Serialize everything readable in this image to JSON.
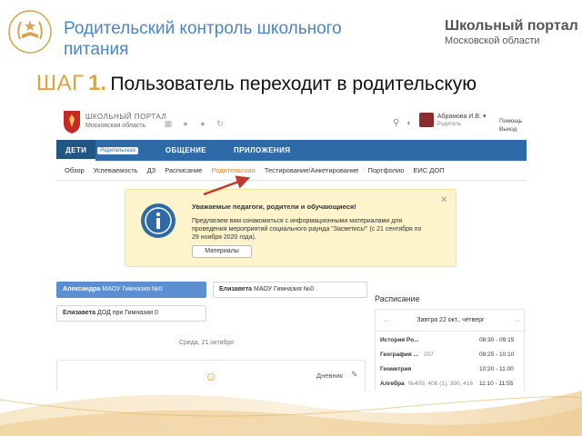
{
  "slide": {
    "title": "Родительский контроль школьного питания",
    "brand_line1": "Школьный портал",
    "brand_line2": "Московской области",
    "step_word": "ШАГ",
    "step_number": "1.",
    "step_text": "Пользователь переходит в родительскую"
  },
  "portal": {
    "logo_line1": "ШКОЛЬНЫЙ ПОРТАЛ",
    "logo_line2": "Московская область",
    "user_name": "Абрамова И.В. ▾",
    "user_role": "Родитель",
    "help_link": "Помощь",
    "logout_link": "Выход"
  },
  "nav": {
    "children": "ДЕТИ",
    "children_badge": "Родительская",
    "communication": "ОБЩЕНИЕ",
    "apps": "ПРИЛОЖЕНИЯ"
  },
  "subnav": {
    "items": [
      "Обзор",
      "Успеваемость",
      "ДЗ",
      "Расписание",
      "Родительская",
      "Тестирование/Анкетирование",
      "Портфолио",
      "ЕИС ДОП"
    ]
  },
  "notice": {
    "title": "Уважаемые педагоги, родители и обучающиеся!",
    "body": "Предлагаем вам ознакомиться с информационными материалами для проведения мероприятий социального раунда \"Засветись!\" (с 21 сентября по 29 ноября 2020 года).",
    "button": "Материалы",
    "close": "✕"
  },
  "children": [
    {
      "name": "Александра",
      "school": "МАОУ Гимназия №0"
    },
    {
      "name": "Елизавета",
      "school": "МАОУ Гимназия №0"
    },
    {
      "name": "Елизавета",
      "school": "ДОД при Гимназии 0"
    }
  ],
  "diary": {
    "date": "Среда, 21 октября",
    "label": "Дневник"
  },
  "schedule": {
    "title": "Расписание",
    "day": "Завтра 22 окт., четверг",
    "rows": [
      {
        "subject": "История Ро...",
        "room": "",
        "time": "08:30 - 09:15"
      },
      {
        "subject": "География ...",
        "room": "207",
        "time": "09:25 - 10:10"
      },
      {
        "subject": "Геометрия",
        "room": "",
        "time": "10:20 - 11:00"
      },
      {
        "subject": "Алгебра",
        "room": "№409, 406 (1), 390, 416",
        "time": "11:10 - 11:55"
      }
    ]
  },
  "colors": {
    "title_blue": "#4a86c5",
    "step_orange": "#e8a13a",
    "nav_blue": "#2e6aa8",
    "selected_card": "#5b8fd1",
    "notice_bg": "#fdf4cc",
    "arrow_red": "#c0392b"
  },
  "icons": {
    "slide_logo": "laurel-book-icon",
    "portal_logo": "moscow-region-emblem-icon",
    "notice": "info-icon",
    "diary": "thinking-face-icon"
  }
}
